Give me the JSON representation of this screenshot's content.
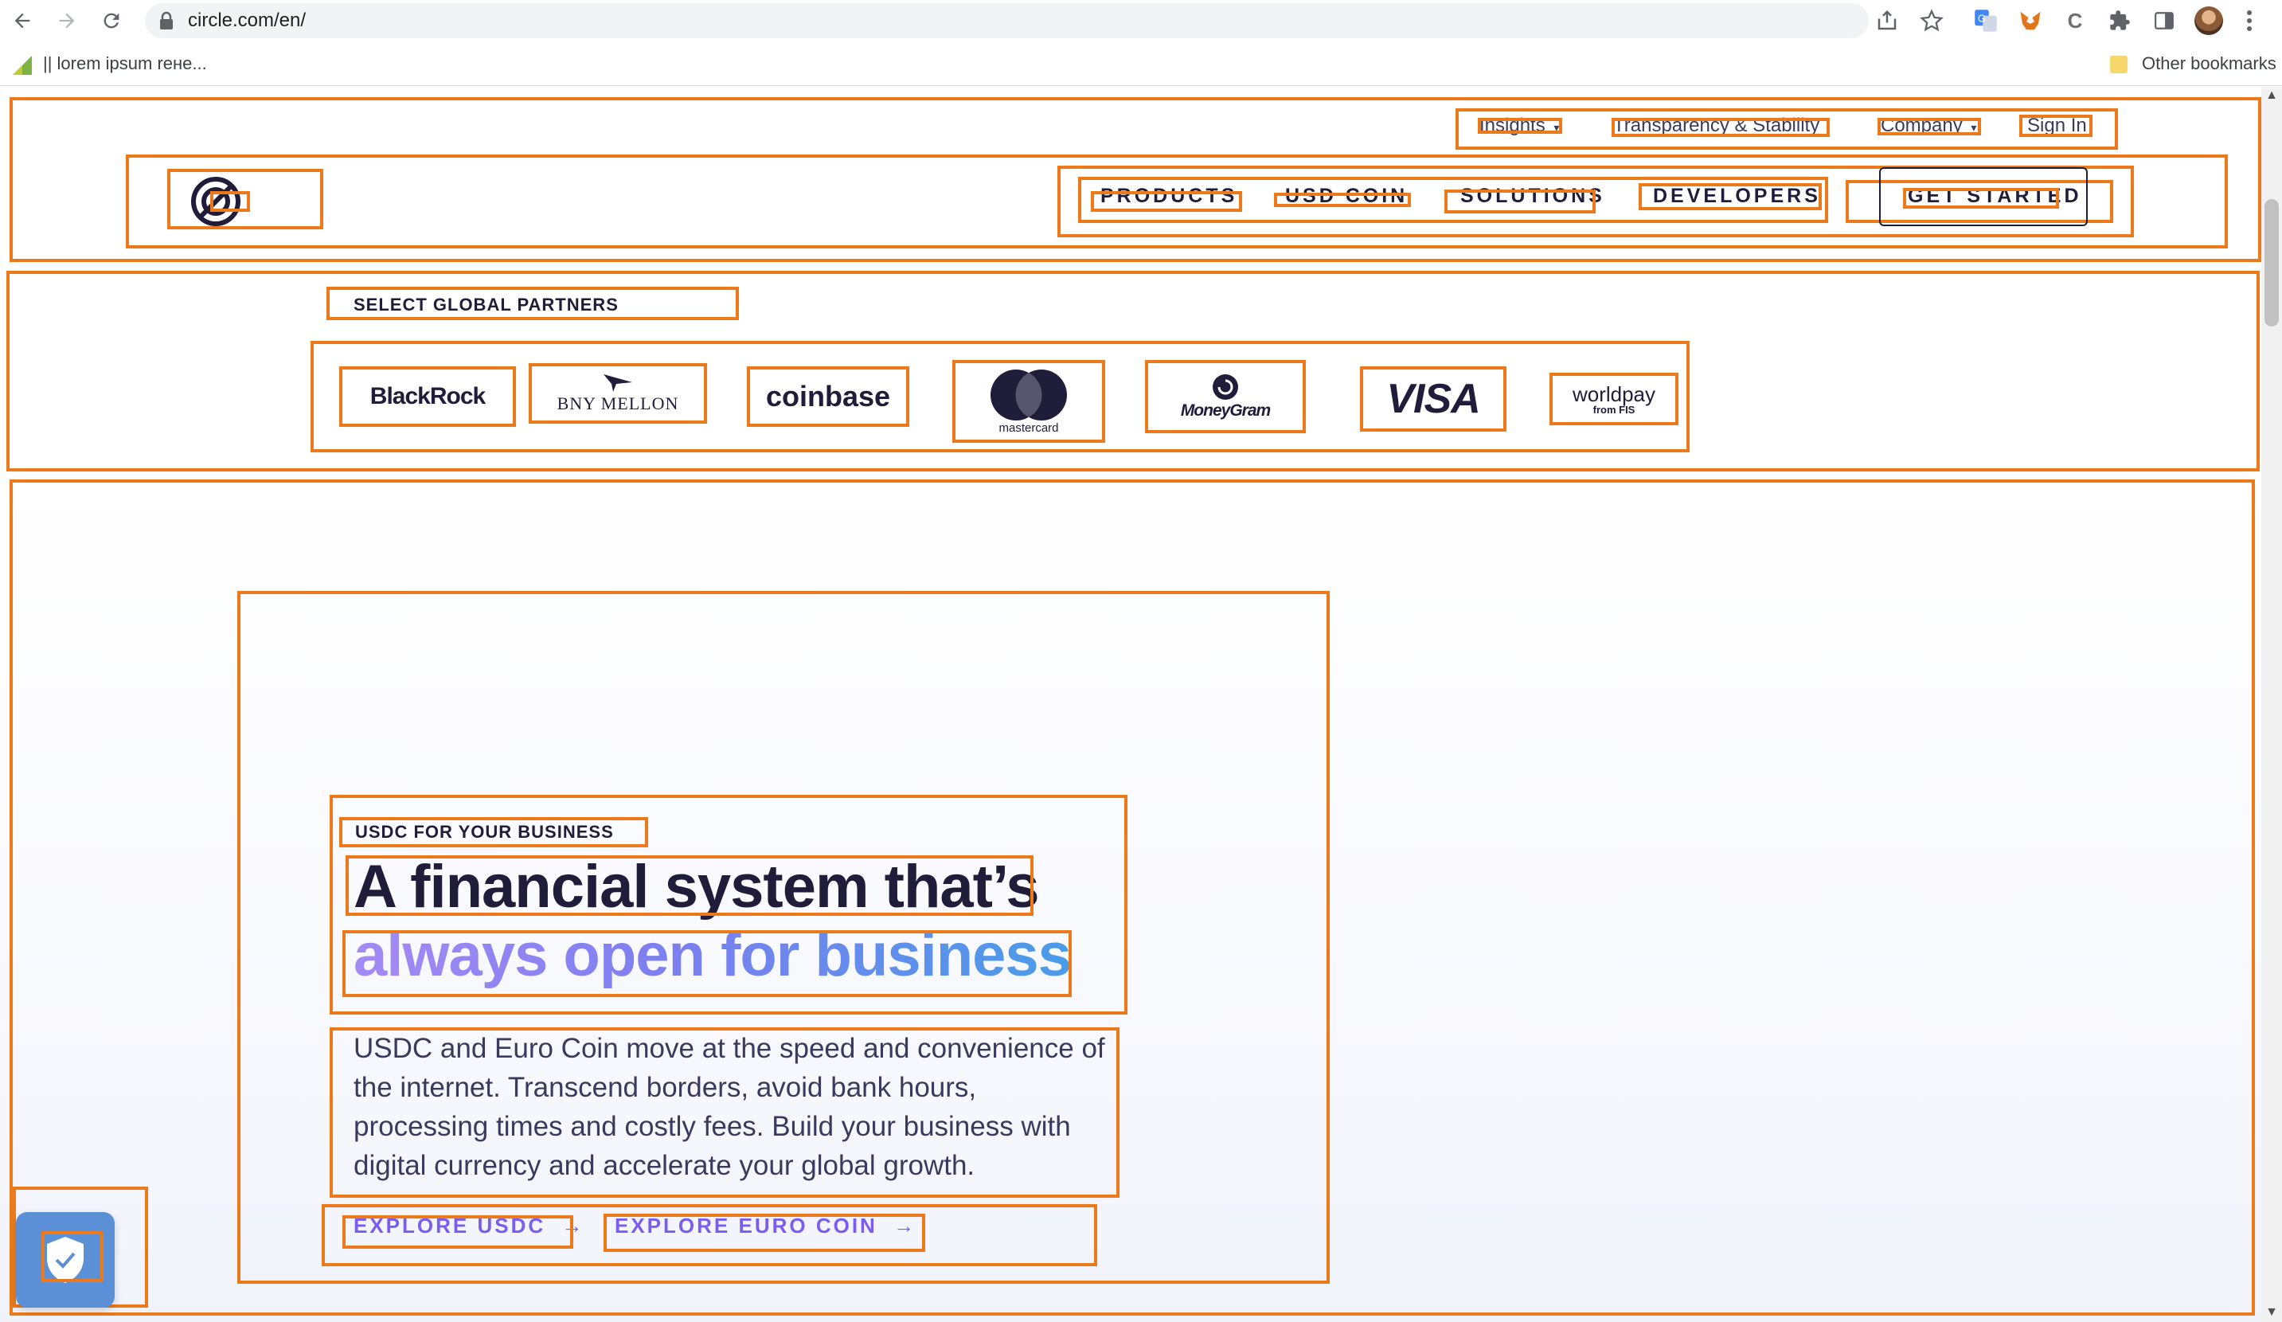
{
  "browser": {
    "url": "circle.com/en/",
    "bookmark_label": "|| lorem ipsum rене...",
    "other_bookmarks": "Other bookmarks",
    "icons": [
      "back-icon",
      "forward-icon",
      "reload-icon",
      "lock-icon",
      "share-icon",
      "star-icon",
      "translate-icon",
      "metamask-icon",
      "extension-c-icon",
      "puzzle-icon",
      "sidepanel-icon",
      "profile-avatar",
      "kebab-menu-icon"
    ]
  },
  "header": {
    "top_links": {
      "insights": "Insights",
      "transparency": "Transparency & Stability",
      "company": "Company",
      "sign_in": "Sign In"
    },
    "nav": {
      "products": "PRODUCTS",
      "usd_coin": "USD COIN",
      "solutions": "SOLUTIONS",
      "developers": "DEVELOPERS",
      "get_started": "GET STARTED"
    }
  },
  "partners": {
    "heading": "SELECT GLOBAL PARTNERS",
    "logos": {
      "blackrock": "BlackRock",
      "bny_mellon": "BNY MELLON",
      "coinbase": "coinbase",
      "mastercard": "mastercard",
      "moneygram": "MoneyGram",
      "visa": "VISA",
      "worldpay": "worldpay",
      "worldpay_sub": "from FIS"
    }
  },
  "hero": {
    "eyebrow": "USDC FOR YOUR BUSINESS",
    "headline_line1": "A financial system that’s",
    "headline_line2": "always open for business",
    "body": "USDC and Euro Coin move at the speed and convenience of the internet. Transcend borders, avoid bank hours, processing times and costly fees. Build your business with digital currency and accelerate your global growth.",
    "cta_usdc": "EXPLORE USDC",
    "cta_euro": "EXPLORE EURO COIN",
    "arrow": "→"
  },
  "colors": {
    "accent": "#7b5cf0",
    "navy": "#1f1d3a",
    "annotation_orange": "#ec7a1b",
    "gradient_start": "#a48af5",
    "gradient_end": "#4a9ce8",
    "shield_blue": "#5b8fd6"
  }
}
